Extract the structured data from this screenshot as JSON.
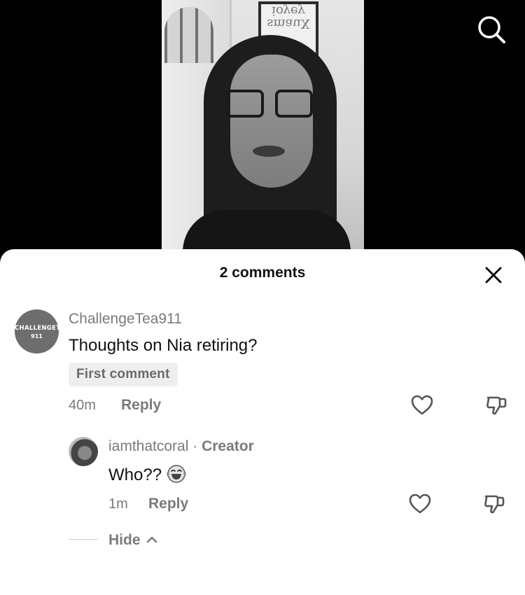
{
  "video": {
    "poster_text_top": "ioyey",
    "poster_text_bottom": "smauX"
  },
  "top_bar": {
    "search_icon": "search-icon"
  },
  "comments_sheet": {
    "title": "2 comments",
    "close_icon": "close-icon",
    "comments": [
      {
        "avatar_text_line1": "CHALLENGETEA",
        "avatar_text_line2": "911",
        "username": "ChallengeTea911",
        "text": "Thoughts on Nia retiring?",
        "badge": "First comment",
        "time": "40m",
        "reply_label": "Reply",
        "like_icon": "heart-icon",
        "dislike_icon": "thumbs-down-icon"
      }
    ],
    "reply": {
      "username": "iamthatcoral",
      "separator": " · ",
      "role": "Creator",
      "text": "Who??",
      "emoji_icon": "laughing-emoji-icon",
      "time": "1m",
      "reply_label": "Reply",
      "like_icon": "heart-icon",
      "dislike_icon": "thumbs-down-icon"
    },
    "hide_label": "Hide",
    "hide_icon": "chevron-up-icon"
  }
}
